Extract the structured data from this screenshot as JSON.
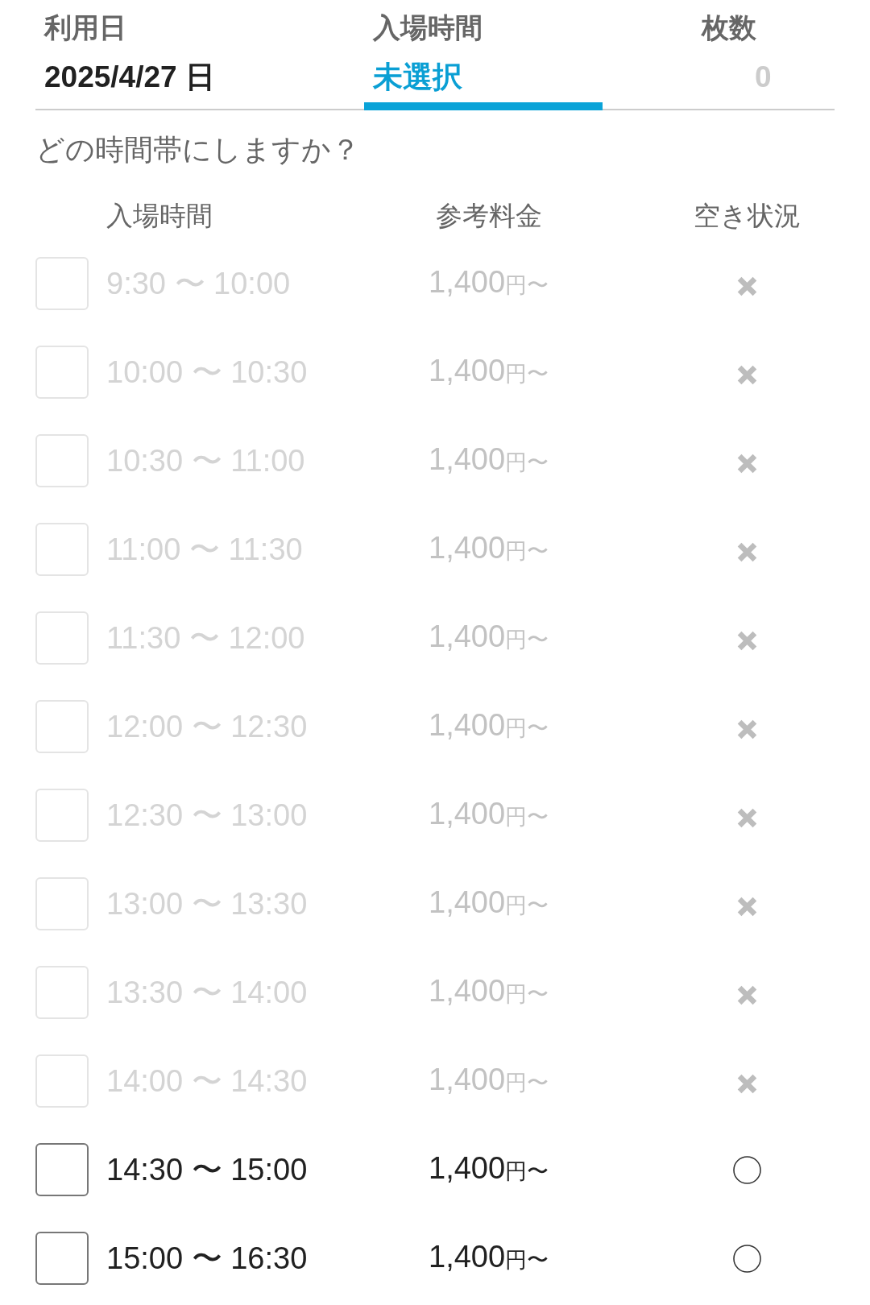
{
  "tabs": [
    {
      "label": "利用日",
      "value": "2025/4/27 日",
      "selected": false,
      "disabled": false
    },
    {
      "label": "入場時間",
      "value": "未選択",
      "selected": true,
      "disabled": false
    },
    {
      "label": "枚数",
      "value": "0",
      "selected": false,
      "disabled": true
    }
  ],
  "question": "どの時間帯にしますか？",
  "table": {
    "columns": [
      "入場時間",
      "参考料金",
      "空き状況"
    ],
    "rows": [
      {
        "time": "9:30 〜 10:00",
        "price": "1,400",
        "price_unit": "円〜",
        "checked": false,
        "disabled": true,
        "available": false
      },
      {
        "time": "10:00 〜 10:30",
        "price": "1,400",
        "price_unit": "円〜",
        "checked": false,
        "disabled": true,
        "available": false
      },
      {
        "time": "10:30 〜 11:00",
        "price": "1,400",
        "price_unit": "円〜",
        "checked": false,
        "disabled": true,
        "available": false
      },
      {
        "time": "11:00 〜 11:30",
        "price": "1,400",
        "price_unit": "円〜",
        "checked": false,
        "disabled": true,
        "available": false
      },
      {
        "time": "11:30 〜 12:00",
        "price": "1,400",
        "price_unit": "円〜",
        "checked": false,
        "disabled": true,
        "available": false
      },
      {
        "time": "12:00 〜 12:30",
        "price": "1,400",
        "price_unit": "円〜",
        "checked": false,
        "disabled": true,
        "available": false
      },
      {
        "time": "12:30 〜 13:00",
        "price": "1,400",
        "price_unit": "円〜",
        "checked": false,
        "disabled": true,
        "available": false
      },
      {
        "time": "13:00 〜 13:30",
        "price": "1,400",
        "price_unit": "円〜",
        "checked": false,
        "disabled": true,
        "available": false
      },
      {
        "time": "13:30 〜 14:00",
        "price": "1,400",
        "price_unit": "円〜",
        "checked": false,
        "disabled": true,
        "available": false
      },
      {
        "time": "14:00 〜 14:30",
        "price": "1,400",
        "price_unit": "円〜",
        "checked": false,
        "disabled": true,
        "available": false
      },
      {
        "time": "14:30 〜 15:00",
        "price": "1,400",
        "price_unit": "円〜",
        "checked": false,
        "disabled": false,
        "available": true
      },
      {
        "time": "15:00 〜 16:30",
        "price": "1,400",
        "price_unit": "円〜",
        "checked": false,
        "disabled": false,
        "available": true
      }
    ]
  }
}
